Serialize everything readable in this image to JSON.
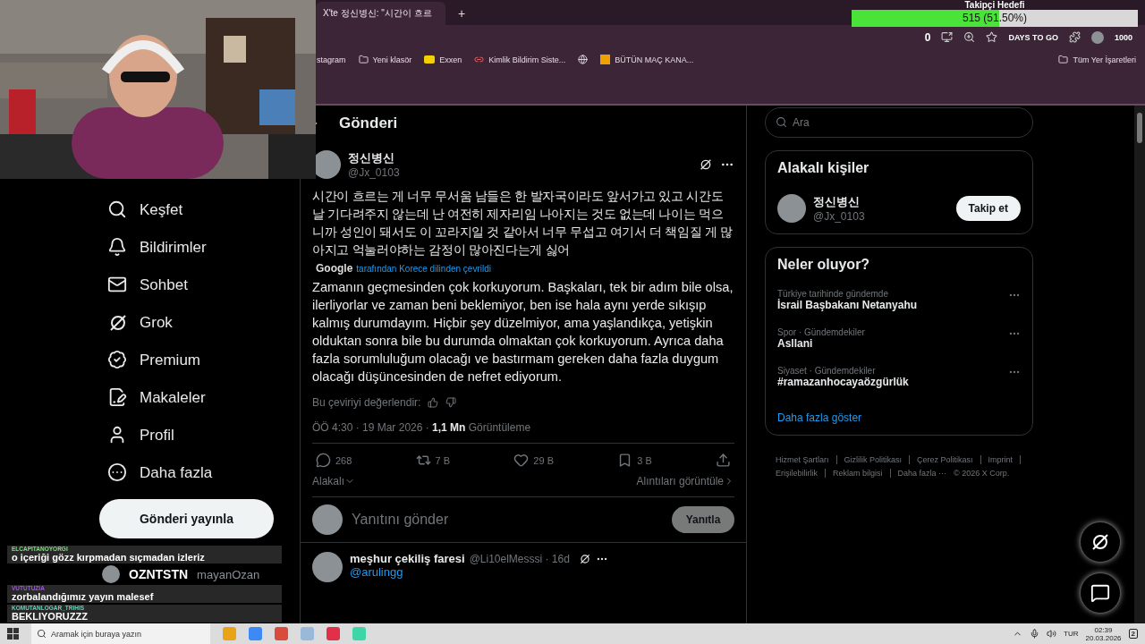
{
  "browser": {
    "tab_title": "X'te 정신병신: \"시간이 흐르",
    "new_tab": "+",
    "counter": "0",
    "overlay_text": "DAYS TO GO",
    "badge": "1000",
    "bookmarks": [
      {
        "label": "stagram",
        "kind": "site"
      },
      {
        "label": "Yeni klasör",
        "kind": "folder"
      },
      {
        "label": "Exxen",
        "kind": "exxen"
      },
      {
        "label": "Kimlik Bildirim Siste...",
        "kind": "link"
      },
      {
        "kind": "globe"
      },
      {
        "label": "BÜTÜN MAÇ KANA...",
        "kind": "jp"
      }
    ],
    "all_bookmarks": "Tüm Yer İşaretleri"
  },
  "follower_goal": {
    "title": "Takipçi Hedefi",
    "reading": "515 (51.50%)",
    "level": 0.515
  },
  "sidebar": {
    "nav": [
      "Keşfet",
      "Bildirimler",
      "Sohbet",
      "Grok",
      "Premium",
      "Makaleler",
      "Profil",
      "Daha fazla"
    ],
    "post_button": "Gönderi yayınla",
    "account": {
      "name": "OZNTSTN",
      "handle": "mayanOzan"
    }
  },
  "post": {
    "header": "Gönderi",
    "author": {
      "name": "정신병신",
      "handle": "@Jx_0103"
    },
    "original_text": "시간이 흐르는 게 너무 무서움  남들은 한 발자국이라도 앞서가고 있고 시간도 날 기다려주지 않는데 난 여전히 제자리임 나아지는 것도 없는데 나이는 먹으니까 성인이 돼서도 이 꼬라지일 것 같아서 너무 무섭고 여기서 더 책임질 게 많아지고 억눌러야하는 감정이 많아진다는게 싫어",
    "translation_brand": "Google",
    "translation_note": "tarafından Korece dilinden çevrildi",
    "translated_text": "Zamanın geçmesinden çok korkuyorum. Başkaları, tek bir adım bile olsa, ilerliyorlar ve zaman beni beklemiyor, ben ise hala aynı yerde sıkışıp kalmış durumdayım. Hiçbir şey düzelmiyor, ama yaşlandıkça, yetişkin olduktan sonra bile bu durumda olmaktan çok korkuyorum. Ayrıca daha fazla sorumluluğum olacağı ve bastırmam gereken daha fazla duygum olacağı düşüncesinden de nefret ediyorum.",
    "rate_label": "Bu çeviriyi değerlendir:",
    "meta": "ÖÖ 4:30 · 19 Mar 2026 · **1,1 Mn** Görüntüleme",
    "stats": [
      "268",
      "7 B",
      "29 B",
      "3 B"
    ],
    "relevance": "Alakalı",
    "quotes": "Alıntıları görüntüle",
    "reply": {
      "placeholder": "Yanıtını gönder",
      "button": "Yanıtla"
    },
    "replies": [
      {
        "name": "meşhur çekiliş faresi",
        "handle": "@Li10elMesssi · 16d",
        "mention": "@arulingg"
      }
    ]
  },
  "right": {
    "search_placeholder": "Ara",
    "people": {
      "title": "Alakalı kişiler",
      "items": [
        {
          "name": "정신병신",
          "handle": "@Jx_0103",
          "button": "Takip et"
        }
      ]
    },
    "trends": {
      "title": "Neler oluyor?",
      "items": [
        {
          "context": "Türkiye tarihinde gündemde",
          "topic": "İsrail Başbakanı Netanyahu"
        },
        {
          "context": "Spor · Gündemdekiler",
          "topic": "Asllani"
        },
        {
          "context": "Siyaset · Gündemdekiler",
          "topic": "#ramazanhocayaözgürlük"
        }
      ],
      "more": "Daha fazla göster"
    },
    "footer": [
      "Hizmet Şartları",
      "Gizlilik Politikası",
      "Çerez Politikası",
      "Imprint",
      "Erişilebilirlik",
      "Reklam bilgisi",
      "Daha fazla ···"
    ],
    "copyright": "© 2026 X Corp."
  },
  "chat": [
    {
      "user": "ELCAPITANOYORGI",
      "color": "#7be07b",
      "message": "o içeriği gözz kırpmadan sıçmadan izleriz"
    },
    {
      "user": "VUTUTUZIA",
      "color": "#a05ad8",
      "message": "zorbalandığımız yayın malesef"
    },
    {
      "user": "KOMUTANLOGAR_TRIHIS",
      "color": "#5fd3b8",
      "message": "BEKLIYORUZZZ"
    }
  ],
  "taskbar": {
    "search_placeholder": "Aramak için buraya yazın",
    "language": "TUR",
    "time": "02:39",
    "date": "20.03.2026",
    "notifications": "2"
  }
}
